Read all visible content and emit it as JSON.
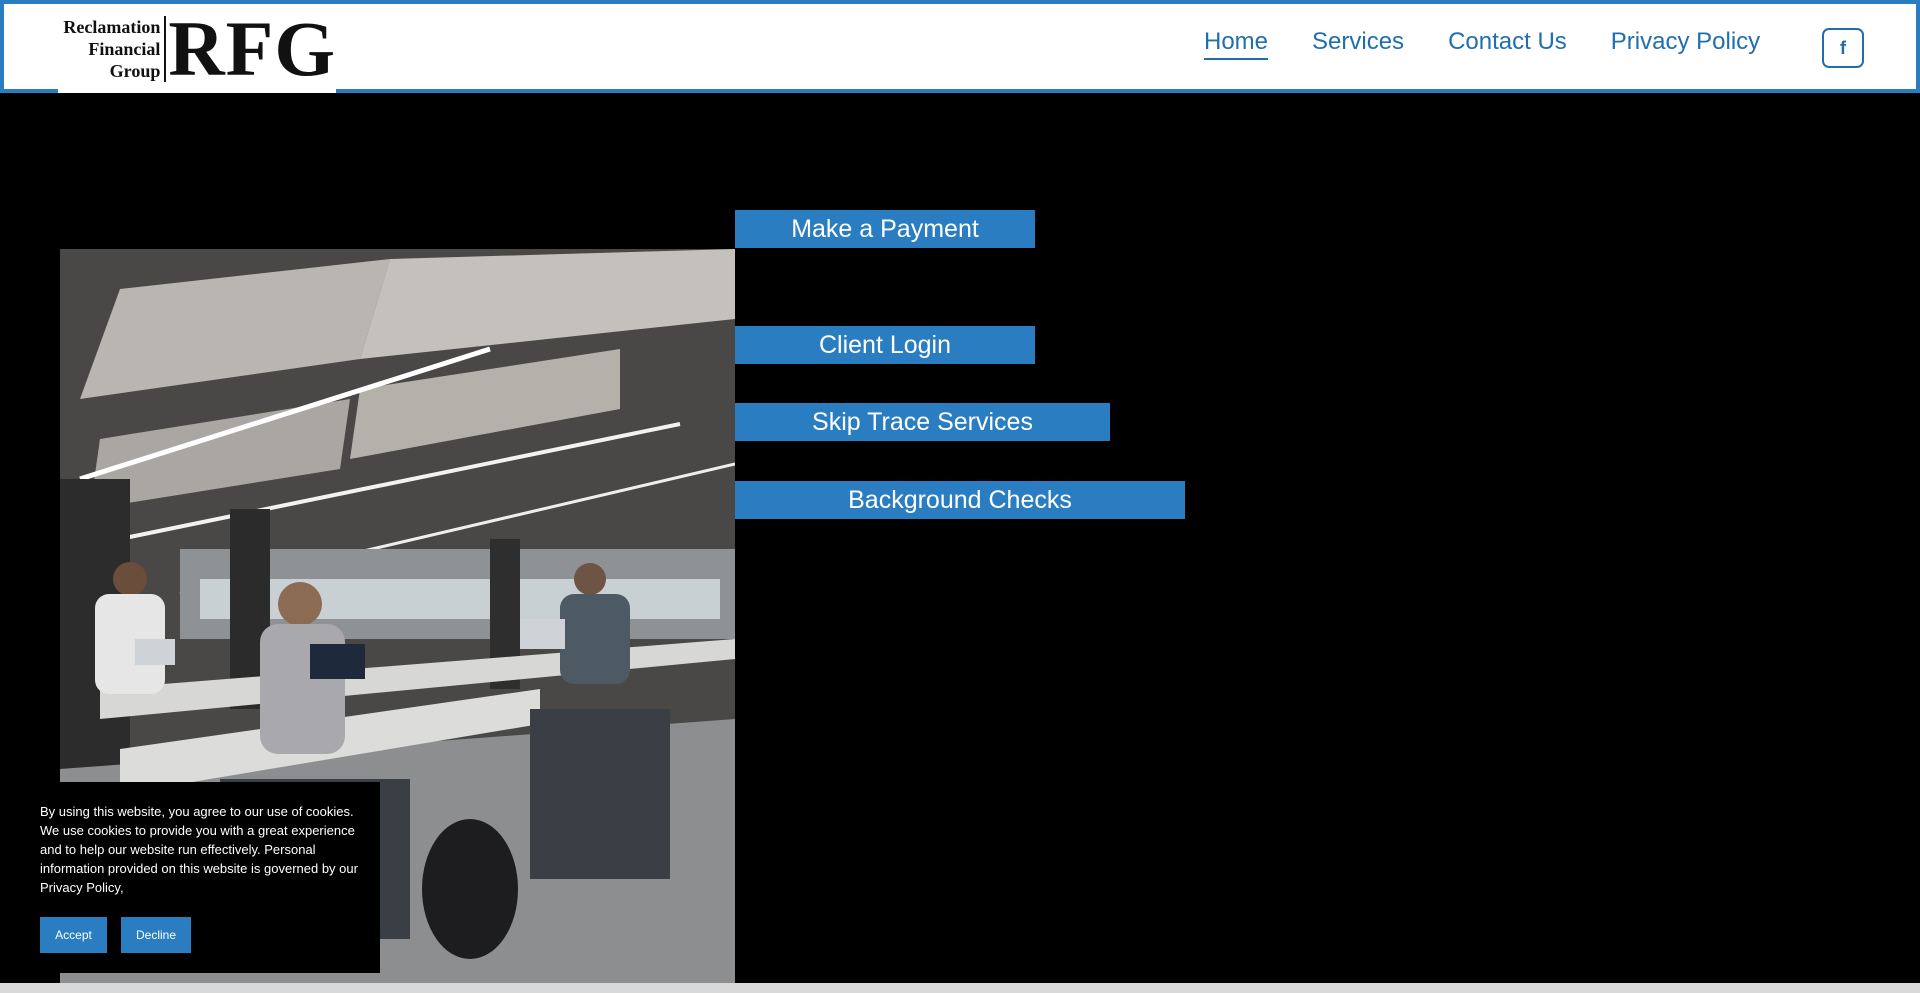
{
  "logo": {
    "words": [
      "Reclamation",
      "Financial",
      "Group"
    ],
    "mark": "RFG"
  },
  "nav": {
    "items": [
      {
        "label": "Home",
        "active": true
      },
      {
        "label": "Services",
        "active": false
      },
      {
        "label": "Contact Us",
        "active": false
      },
      {
        "label": "Privacy Policy",
        "active": false
      }
    ],
    "facebook_icon": "facebook-icon",
    "facebook_glyph": "f"
  },
  "hero": {
    "image_icon": "office-photo"
  },
  "actions": {
    "make_payment": "Make a Payment",
    "client_login": "Client Login",
    "skip_trace": "Skip Trace Services",
    "background_checks": "Background Checks"
  },
  "cookie": {
    "message": "By using this website, you agree to our use of cookies. We use cookies to provide you with a great experience and to help our website run effectively. Personal information provided on this website is governed by our Privacy Policy,",
    "accept": "Accept",
    "decline": "Decline"
  },
  "colors": {
    "accent": "#2a7dc0",
    "link": "#1f6fb0",
    "background": "#000000"
  }
}
